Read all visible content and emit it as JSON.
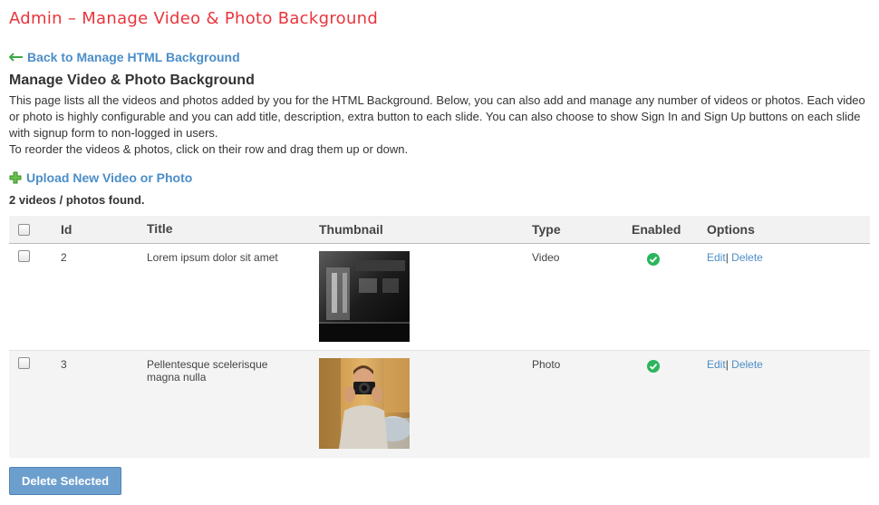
{
  "header": {
    "title": "Admin – Manage Video & Photo Background"
  },
  "nav": {
    "back_label": "Back to Manage HTML Background",
    "back_icon": "arrow-left-icon"
  },
  "section": {
    "title": "Manage Video & Photo Background",
    "description": "This page lists all the videos and photos added by you for the HTML Background. Below, you can also add and manage any number of videos or photos. Each video or photo is highly configurable and you can add title, description, extra button to each slide. You can also choose to show Sign In and Sign Up buttons on each slide with signup form to non-logged in users.",
    "reorder_hint": "To reorder the videos & photos, click on their row and drag them up or down."
  },
  "upload": {
    "label": "Upload New Video or Photo",
    "icon": "plus-icon"
  },
  "summary": "2 videos / photos found.",
  "table": {
    "columns": {
      "id": "Id",
      "title": "Title",
      "thumbnail": "Thumbnail",
      "type": "Type",
      "enabled": "Enabled",
      "options": "Options"
    },
    "rows": [
      {
        "id": "2",
        "title": "Lorem ipsum dolor sit amet",
        "thumbnail": "train-video-thumbnail",
        "type": "Video",
        "enabled": true,
        "edit": "Edit",
        "sep": "|",
        "delete": "Delete"
      },
      {
        "id": "3",
        "title": "Pellentesque scelerisque magna nulla",
        "thumbnail": "photographer-photo-thumbnail",
        "type": "Photo",
        "enabled": true,
        "edit": "Edit",
        "sep": "|",
        "delete": "Delete"
      }
    ]
  },
  "actions": {
    "delete_selected": "Delete Selected"
  },
  "colors": {
    "title": "#e8353d",
    "link": "#4b8ec8",
    "button": "#6d9fce",
    "enabled": "#2bb55c"
  }
}
